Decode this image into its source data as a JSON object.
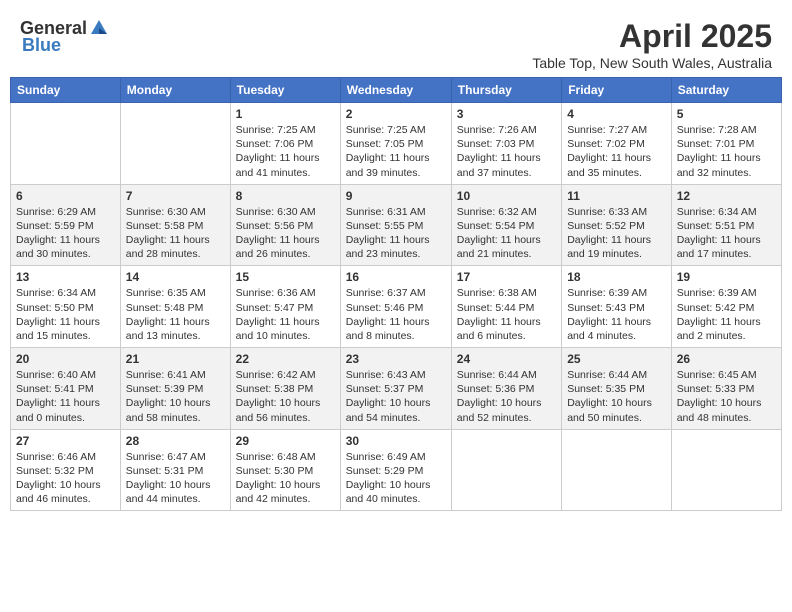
{
  "header": {
    "logo_general": "General",
    "logo_blue": "Blue",
    "main_title": "April 2025",
    "subtitle": "Table Top, New South Wales, Australia"
  },
  "days_of_week": [
    "Sunday",
    "Monday",
    "Tuesday",
    "Wednesday",
    "Thursday",
    "Friday",
    "Saturday"
  ],
  "weeks": [
    [
      {
        "day": "",
        "sunrise": "",
        "sunset": "",
        "daylight": ""
      },
      {
        "day": "",
        "sunrise": "",
        "sunset": "",
        "daylight": ""
      },
      {
        "day": "1",
        "sunrise": "Sunrise: 7:25 AM",
        "sunset": "Sunset: 7:06 PM",
        "daylight": "Daylight: 11 hours and 41 minutes."
      },
      {
        "day": "2",
        "sunrise": "Sunrise: 7:25 AM",
        "sunset": "Sunset: 7:05 PM",
        "daylight": "Daylight: 11 hours and 39 minutes."
      },
      {
        "day": "3",
        "sunrise": "Sunrise: 7:26 AM",
        "sunset": "Sunset: 7:03 PM",
        "daylight": "Daylight: 11 hours and 37 minutes."
      },
      {
        "day": "4",
        "sunrise": "Sunrise: 7:27 AM",
        "sunset": "Sunset: 7:02 PM",
        "daylight": "Daylight: 11 hours and 35 minutes."
      },
      {
        "day": "5",
        "sunrise": "Sunrise: 7:28 AM",
        "sunset": "Sunset: 7:01 PM",
        "daylight": "Daylight: 11 hours and 32 minutes."
      }
    ],
    [
      {
        "day": "6",
        "sunrise": "Sunrise: 6:29 AM",
        "sunset": "Sunset: 5:59 PM",
        "daylight": "Daylight: 11 hours and 30 minutes."
      },
      {
        "day": "7",
        "sunrise": "Sunrise: 6:30 AM",
        "sunset": "Sunset: 5:58 PM",
        "daylight": "Daylight: 11 hours and 28 minutes."
      },
      {
        "day": "8",
        "sunrise": "Sunrise: 6:30 AM",
        "sunset": "Sunset: 5:56 PM",
        "daylight": "Daylight: 11 hours and 26 minutes."
      },
      {
        "day": "9",
        "sunrise": "Sunrise: 6:31 AM",
        "sunset": "Sunset: 5:55 PM",
        "daylight": "Daylight: 11 hours and 23 minutes."
      },
      {
        "day": "10",
        "sunrise": "Sunrise: 6:32 AM",
        "sunset": "Sunset: 5:54 PM",
        "daylight": "Daylight: 11 hours and 21 minutes."
      },
      {
        "day": "11",
        "sunrise": "Sunrise: 6:33 AM",
        "sunset": "Sunset: 5:52 PM",
        "daylight": "Daylight: 11 hours and 19 minutes."
      },
      {
        "day": "12",
        "sunrise": "Sunrise: 6:34 AM",
        "sunset": "Sunset: 5:51 PM",
        "daylight": "Daylight: 11 hours and 17 minutes."
      }
    ],
    [
      {
        "day": "13",
        "sunrise": "Sunrise: 6:34 AM",
        "sunset": "Sunset: 5:50 PM",
        "daylight": "Daylight: 11 hours and 15 minutes."
      },
      {
        "day": "14",
        "sunrise": "Sunrise: 6:35 AM",
        "sunset": "Sunset: 5:48 PM",
        "daylight": "Daylight: 11 hours and 13 minutes."
      },
      {
        "day": "15",
        "sunrise": "Sunrise: 6:36 AM",
        "sunset": "Sunset: 5:47 PM",
        "daylight": "Daylight: 11 hours and 10 minutes."
      },
      {
        "day": "16",
        "sunrise": "Sunrise: 6:37 AM",
        "sunset": "Sunset: 5:46 PM",
        "daylight": "Daylight: 11 hours and 8 minutes."
      },
      {
        "day": "17",
        "sunrise": "Sunrise: 6:38 AM",
        "sunset": "Sunset: 5:44 PM",
        "daylight": "Daylight: 11 hours and 6 minutes."
      },
      {
        "day": "18",
        "sunrise": "Sunrise: 6:39 AM",
        "sunset": "Sunset: 5:43 PM",
        "daylight": "Daylight: 11 hours and 4 minutes."
      },
      {
        "day": "19",
        "sunrise": "Sunrise: 6:39 AM",
        "sunset": "Sunset: 5:42 PM",
        "daylight": "Daylight: 11 hours and 2 minutes."
      }
    ],
    [
      {
        "day": "20",
        "sunrise": "Sunrise: 6:40 AM",
        "sunset": "Sunset: 5:41 PM",
        "daylight": "Daylight: 11 hours and 0 minutes."
      },
      {
        "day": "21",
        "sunrise": "Sunrise: 6:41 AM",
        "sunset": "Sunset: 5:39 PM",
        "daylight": "Daylight: 10 hours and 58 minutes."
      },
      {
        "day": "22",
        "sunrise": "Sunrise: 6:42 AM",
        "sunset": "Sunset: 5:38 PM",
        "daylight": "Daylight: 10 hours and 56 minutes."
      },
      {
        "day": "23",
        "sunrise": "Sunrise: 6:43 AM",
        "sunset": "Sunset: 5:37 PM",
        "daylight": "Daylight: 10 hours and 54 minutes."
      },
      {
        "day": "24",
        "sunrise": "Sunrise: 6:44 AM",
        "sunset": "Sunset: 5:36 PM",
        "daylight": "Daylight: 10 hours and 52 minutes."
      },
      {
        "day": "25",
        "sunrise": "Sunrise: 6:44 AM",
        "sunset": "Sunset: 5:35 PM",
        "daylight": "Daylight: 10 hours and 50 minutes."
      },
      {
        "day": "26",
        "sunrise": "Sunrise: 6:45 AM",
        "sunset": "Sunset: 5:33 PM",
        "daylight": "Daylight: 10 hours and 48 minutes."
      }
    ],
    [
      {
        "day": "27",
        "sunrise": "Sunrise: 6:46 AM",
        "sunset": "Sunset: 5:32 PM",
        "daylight": "Daylight: 10 hours and 46 minutes."
      },
      {
        "day": "28",
        "sunrise": "Sunrise: 6:47 AM",
        "sunset": "Sunset: 5:31 PM",
        "daylight": "Daylight: 10 hours and 44 minutes."
      },
      {
        "day": "29",
        "sunrise": "Sunrise: 6:48 AM",
        "sunset": "Sunset: 5:30 PM",
        "daylight": "Daylight: 10 hours and 42 minutes."
      },
      {
        "day": "30",
        "sunrise": "Sunrise: 6:49 AM",
        "sunset": "Sunset: 5:29 PM",
        "daylight": "Daylight: 10 hours and 40 minutes."
      },
      {
        "day": "",
        "sunrise": "",
        "sunset": "",
        "daylight": ""
      },
      {
        "day": "",
        "sunrise": "",
        "sunset": "",
        "daylight": ""
      },
      {
        "day": "",
        "sunrise": "",
        "sunset": "",
        "daylight": ""
      }
    ]
  ]
}
